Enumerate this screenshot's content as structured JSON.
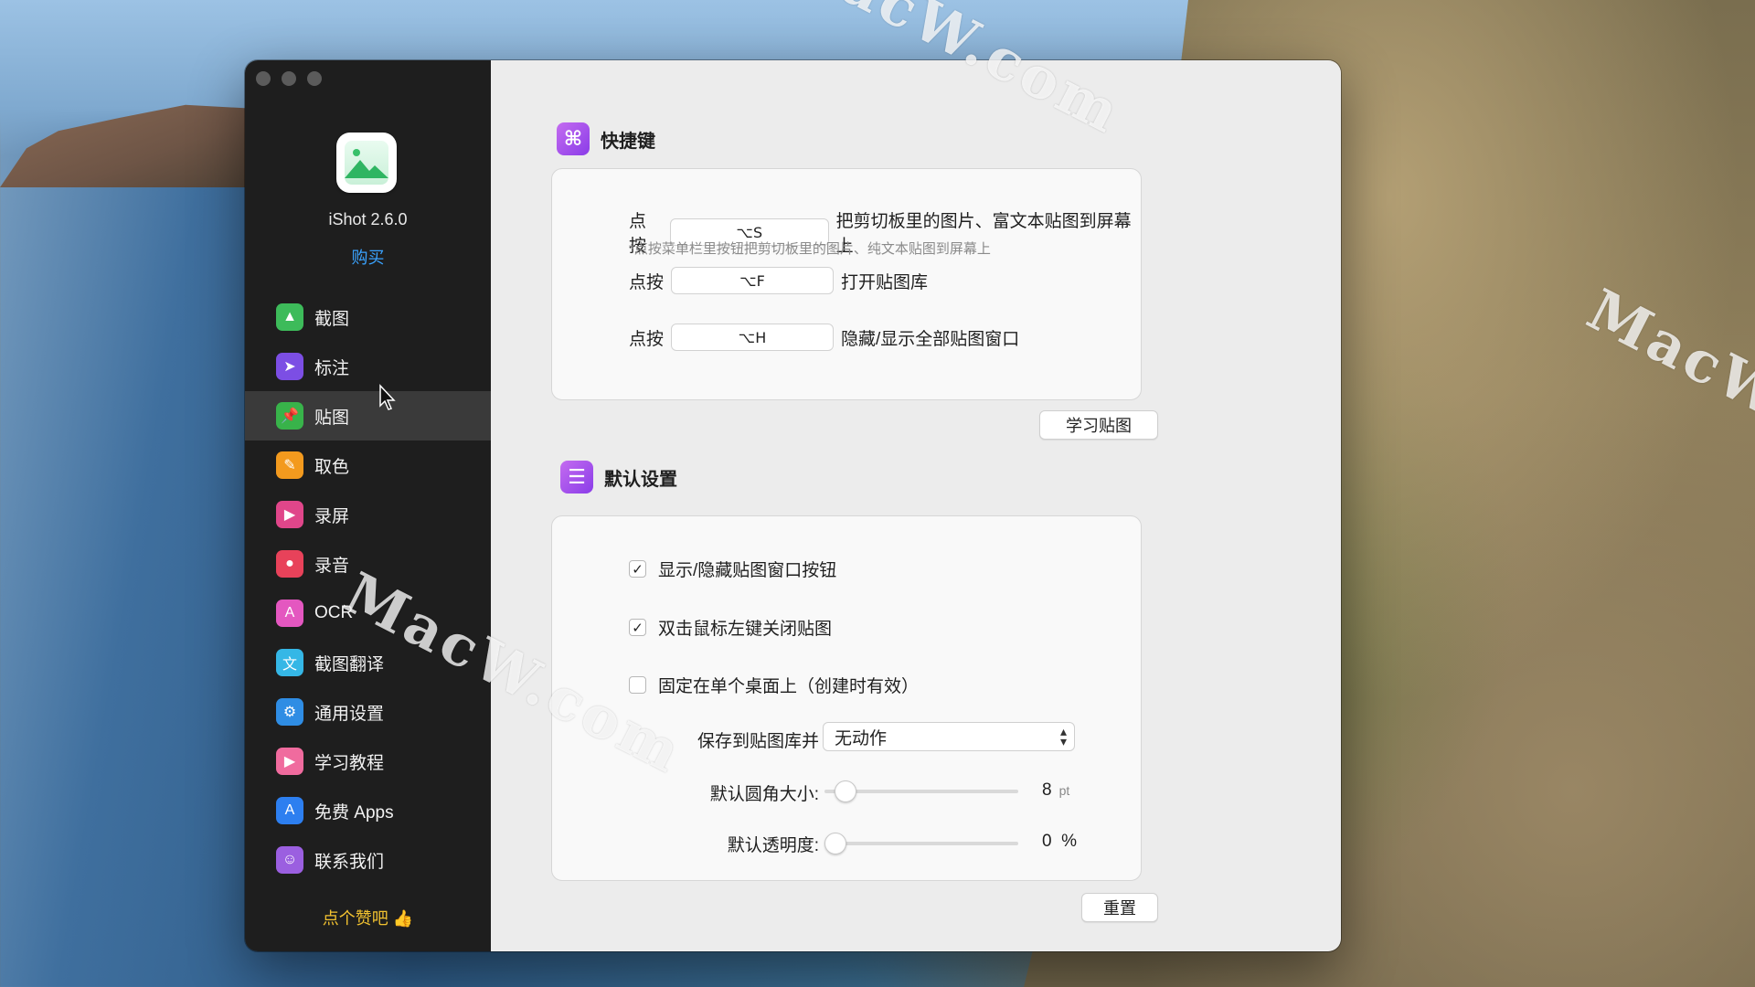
{
  "watermark": {
    "text": "MacW.com"
  },
  "app": {
    "name": "iShot 2.6.0",
    "buy": "购买",
    "like": "点个赞吧 👍"
  },
  "sidebar": {
    "items": [
      {
        "label": "截图",
        "icon": "image-icon",
        "color": "#3dbb5a"
      },
      {
        "label": "标注",
        "icon": "cursor-icon",
        "color": "#7c4ee4"
      },
      {
        "label": "贴图",
        "icon": "pin-icon",
        "color": "#38b34a"
      },
      {
        "label": "取色",
        "icon": "eyedropper-icon",
        "color": "#f39a1e"
      },
      {
        "label": "录屏",
        "icon": "video-icon",
        "color": "#e0468a"
      },
      {
        "label": "录音",
        "icon": "mic-icon",
        "color": "#e8425a"
      },
      {
        "label": "OCR",
        "icon": "ocr-icon",
        "color": "#e457c0"
      },
      {
        "label": "截图翻译",
        "icon": "translate-icon",
        "color": "#35b7e6"
      },
      {
        "label": "通用设置",
        "icon": "gear-icon",
        "color": "#2f8de4"
      },
      {
        "label": "学习教程",
        "icon": "tutorial-icon",
        "color": "#f06b9e"
      },
      {
        "label": "免费 Apps",
        "icon": "appstore-icon",
        "color": "#2d7ff0"
      },
      {
        "label": "联系我们",
        "icon": "contacts-icon",
        "color": "#9b5fe0"
      }
    ],
    "active_index": 2
  },
  "shortcuts": {
    "title": "快捷键",
    "press": "点按",
    "rows": [
      {
        "key": "⌥S",
        "desc": "把剪切板里的图片、富文本贴图到屏幕上"
      },
      {
        "key": "⌥F",
        "desc": "打开贴图库"
      },
      {
        "key": "⌥H",
        "desc": "隐藏/显示全部贴图窗口"
      }
    ],
    "hint": "*点按菜单栏里按钮把剪切板里的图片、纯文本贴图到屏幕上",
    "learn_button": "学习贴图"
  },
  "defaults": {
    "title": "默认设置",
    "checks": [
      {
        "label": "显示/隐藏贴图窗口按钮",
        "checked": true,
        "mark": "✓"
      },
      {
        "label": "双击鼠标左键关闭贴图",
        "checked": true,
        "mark": "✓"
      },
      {
        "label": "固定在单个桌面上（创建时有效）",
        "checked": false,
        "mark": ""
      }
    ],
    "save_label": "保存到贴图库并",
    "save_value": "无动作",
    "corner_label": "默认圆角大小:",
    "corner_value": "8",
    "corner_unit": "pt",
    "corner_level": 0.06,
    "opacity_label": "默认透明度:",
    "opacity_value": "0",
    "opacity_unit": "%",
    "opacity_level": 0.0,
    "reset_button": "重置"
  }
}
